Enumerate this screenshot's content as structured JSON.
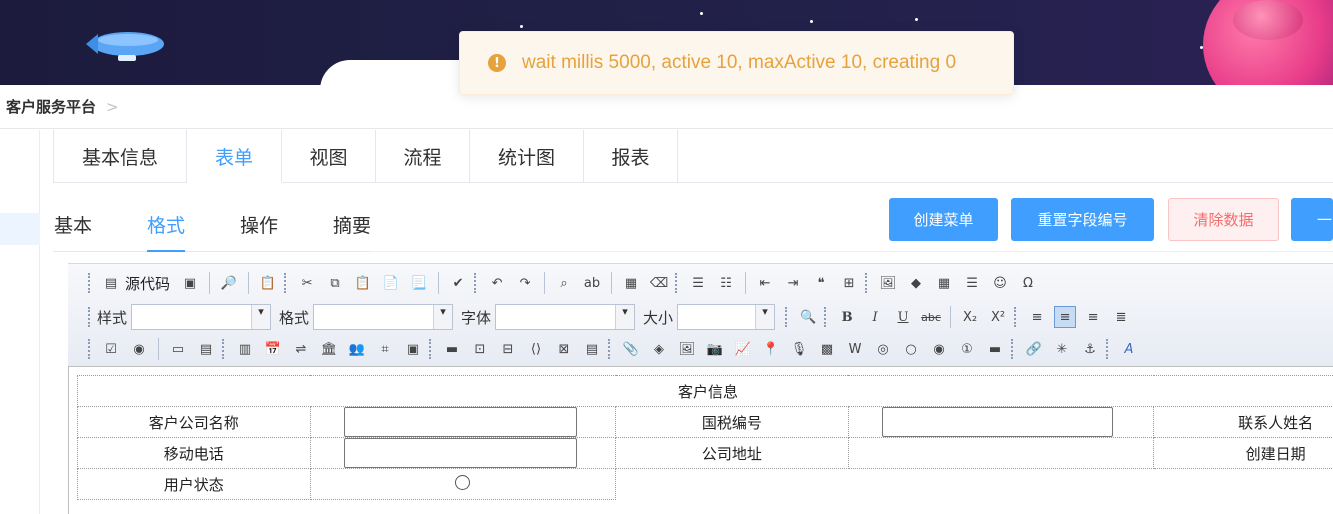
{
  "toast": {
    "icon": "warning-icon",
    "message": "wait millis 5000, active 10, maxActive 10, creating 0"
  },
  "breadcrumb": {
    "label": "客户服务平台",
    "separator": ">"
  },
  "top_tabs": [
    "基本信息",
    "表单",
    "视图",
    "流程",
    "统计图",
    "报表"
  ],
  "top_active": "表单",
  "sub_tabs": [
    "基本",
    "格式",
    "操作",
    "摘要"
  ],
  "sub_active": "格式",
  "buttons": {
    "create_menu": "创建菜单",
    "reset_fields": "重置字段编号",
    "clear_data": "清除数据",
    "partial": "一"
  },
  "toolbar": {
    "source_label": "源代码",
    "style_label": "样式",
    "format_label": "格式",
    "font_label": "字体",
    "size_label": "大小",
    "bold": "B",
    "italic": "I",
    "underline": "U",
    "strike": "abc",
    "sub": "X₂",
    "sup": "X²",
    "omega": "Ω",
    "quote": "❝",
    "anchor": "⚓",
    "find": "🔍"
  },
  "form": {
    "title": "客户信息",
    "labels": {
      "company_name": "客户公司名称",
      "tax_id": "国税编号",
      "contact_name": "联系人姓名",
      "mobile": "移动电话",
      "address": "公司地址",
      "create_date": "创建日期",
      "user_status": "用户状态"
    }
  },
  "colors": {
    "primary": "#409eff",
    "danger": "#f56c6c",
    "warning": "#e6a23c"
  }
}
